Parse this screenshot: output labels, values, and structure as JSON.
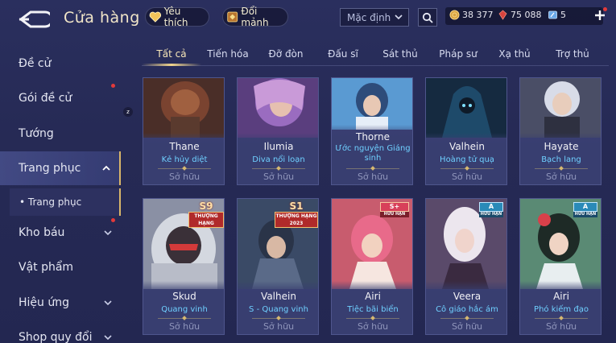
{
  "header": {
    "title": "Cửa hàng",
    "favorites_label": "Yêu thích",
    "exchange_label": "Đổi mảnh",
    "sort_value": "Mặc định",
    "currency": {
      "gold": "38 377",
      "gems": "75 088",
      "vouchers": "5"
    }
  },
  "sidebar": {
    "items": [
      {
        "label": "Đề cử"
      },
      {
        "label": "Gói đề cử"
      },
      {
        "label": "Tướng"
      },
      {
        "label": "Trang phục"
      },
      {
        "label": "Kho báu"
      },
      {
        "label": "Vật phẩm"
      },
      {
        "label": "Hiệu ứng"
      },
      {
        "label": "Shop quy đổi"
      }
    ],
    "sub_item": "• Trang phục",
    "badge_z": "z"
  },
  "tabs": [
    "Tất cả",
    "Tiến hóa",
    "Đỡ đòn",
    "Đấu sĩ",
    "Sát thủ",
    "Pháp sư",
    "Xạ thủ",
    "Trợ thủ"
  ],
  "cards_row1": [
    {
      "hero": "Thane",
      "skin": "Kẻ hủy diệt",
      "status": "Sở hữu",
      "color": "#6b3a2a"
    },
    {
      "hero": "Ilumia",
      "skin": "Diva nổi loạn",
      "status": "Sở hữu",
      "color": "#7a4e9a"
    },
    {
      "hero": "Thorne",
      "skin": "Ước nguyện Giáng sinh",
      "status": "Sở hữu",
      "color": "#4f86b8"
    },
    {
      "hero": "Valhein",
      "skin": "Hoàng tử quạ",
      "status": "Sở hữu",
      "color": "#1e3d57"
    },
    {
      "hero": "Hayate",
      "skin": "Bạch lang",
      "status": "Sở hữu",
      "color": "#5d6177"
    }
  ],
  "cards_row2": [
    {
      "hero": "Skud",
      "skin": "Quang vinh",
      "status": "Sở hữu",
      "tier": "S9",
      "tier_sub": "THƯỢNG HẠNG",
      "color": "#b8bdc6"
    },
    {
      "hero": "Valhein",
      "skin": "S - Quang vinh",
      "status": "Sở hữu",
      "tier": "S1",
      "tier_sub": "THƯỢNG HẠNG 2023",
      "color": "#40577a"
    },
    {
      "hero": "Airi",
      "skin": "Tiệc bãi biển",
      "status": "Sở hữu",
      "tier": "S+",
      "tier_sub": "HỮU HẠN",
      "color": "#d06f7e"
    },
    {
      "hero": "Veera",
      "skin": "Cô giáo hắc ám",
      "status": "Sở hữu",
      "tier": "A",
      "tier_sub": "HỮU HẠN",
      "color": "#8f6fa0"
    },
    {
      "hero": "Airi",
      "skin": "Phó kiếm đạo",
      "status": "Sở hữu",
      "tier": "A",
      "tier_sub": "HỮU HẠN",
      "color": "#3e6a55"
    }
  ],
  "colors": {
    "accent_gold": "#f0d48c",
    "skin_blue": "#6fd0ff",
    "badge_red": "#e23a3a"
  }
}
